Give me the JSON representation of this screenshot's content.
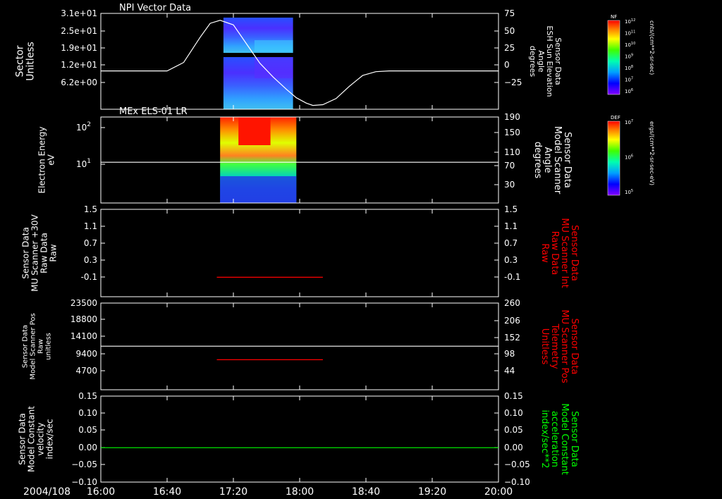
{
  "date_label": "2004/108",
  "time_axis": {
    "ticks": [
      "16:00",
      "16:40",
      "17:20",
      "18:00",
      "18:40",
      "19:20",
      "20:00"
    ],
    "range_minutes": [
      0,
      240
    ]
  },
  "colors": {
    "background": "#000000",
    "axis": "#ffffff",
    "red_series": "#ff0000",
    "green_series": "#00ff00"
  },
  "chart_data": [
    {
      "type": "heatmap",
      "title": "NPI Vector Data",
      "left_axis": {
        "label": [
          "Sector",
          "Unitless"
        ],
        "ticks": [
          "3.1e+01",
          "2.5e+01",
          "1.9e+01",
          "1.2e+01",
          "6.2e+00"
        ]
      },
      "right_axis": {
        "label": [
          "Sensor Data",
          "ESH Sun Elevation",
          "Angle",
          "degrees"
        ],
        "ticks": [
          "75",
          "50",
          "25",
          "0",
          "−25"
        ],
        "range": [
          -50,
          75
        ]
      },
      "spectrogram_time_range": [
        "17:14",
        "17:56"
      ],
      "series": [
        {
          "color": "#ffffff",
          "x_minutes": [
            0,
            40,
            50,
            60,
            66,
            72,
            80,
            88,
            96,
            104,
            112,
            118,
            124,
            128,
            134,
            142,
            150,
            158,
            166,
            174,
            182,
            240
          ],
          "y": [
            0,
            0,
            11,
            44,
            62,
            66,
            60,
            35,
            10,
            -8,
            -24,
            -35,
            -42,
            -45,
            -44,
            -36,
            -20,
            -6,
            -1,
            0,
            0,
            0
          ]
        }
      ],
      "colorbar": {
        "name": "NF",
        "unit": "cnts/(cm**2-sr-sec)",
        "tick_exponents": [
          "12",
          "11",
          "10",
          "9",
          "8",
          "7",
          "6"
        ]
      }
    },
    {
      "type": "heatmap",
      "title": "MEx ELS-01 LR",
      "left_axis": {
        "label": [
          "Electron Energy",
          "eV"
        ],
        "ticks": [
          "10",
          "10"
        ],
        "tick_exponents": [
          "2",
          "1"
        ],
        "scale": "log"
      },
      "right_axis": {
        "label": [
          "Sensor Data",
          "Model Scanner",
          "Angle",
          "degrees"
        ],
        "ticks": [
          "190",
          "150",
          "110",
          "70",
          "30"
        ],
        "range": [
          0,
          190
        ]
      },
      "spectrogram_time_range": [
        "17:12",
        "17:58"
      ],
      "series": [
        {
          "color": "#ffffff",
          "x_minutes": [
            0,
            240
          ],
          "y": [
            90,
            90
          ]
        }
      ],
      "colorbar": {
        "name": "DEF",
        "unit": "ergs/(cm**2-sr-sec-eV)",
        "tick_exponents": [
          "7",
          "6",
          "5"
        ]
      }
    },
    {
      "type": "line",
      "left_axis": {
        "label": [
          "Sensor Data",
          "MU Scanner +30V",
          "Raw Data",
          "Raw"
        ],
        "ticks": [
          "1.5",
          "1.1",
          "0.7",
          "0.3",
          "-0.1"
        ],
        "range": [
          -0.3,
          1.5
        ]
      },
      "right_axis": {
        "label": [
          "Sensor Data",
          "MU Scanner Int",
          "Raw Data",
          "Raw"
        ],
        "label_color": "#ff0000",
        "ticks": [
          "1.5",
          "1.1",
          "0.7",
          "0.3",
          "-0.1"
        ],
        "range": [
          -0.3,
          1.5
        ]
      },
      "series": [
        {
          "color": "#ff0000",
          "x_minutes": [
            70,
            134
          ],
          "y": [
            0.1,
            0.1
          ]
        }
      ]
    },
    {
      "type": "line",
      "left_axis": {
        "label": [
          "Sensor Data",
          "Model Scanner Pos",
          "Raw",
          "unitless"
        ],
        "ticks": [
          "23500",
          "18800",
          "14100",
          "9400",
          "4700"
        ],
        "range": [
          0,
          23500
        ]
      },
      "right_axis": {
        "label": [
          "Sensor Data",
          "MU Scanner Pos",
          "Telemetry",
          "Unitless"
        ],
        "label_color": "#ff0000",
        "ticks": [
          "260",
          "206",
          "152",
          "98",
          "44"
        ],
        "range": [
          0,
          260
        ]
      },
      "series": [
        {
          "color": "#ffffff",
          "axis": "left",
          "x_minutes": [
            0,
            240
          ],
          "y": [
            11800,
            11800
          ]
        },
        {
          "color": "#ff0000",
          "axis": "right",
          "x_minutes": [
            70,
            134
          ],
          "y": [
            90,
            90
          ]
        }
      ]
    },
    {
      "type": "line",
      "left_axis": {
        "label": [
          "Sensor Data",
          "Model Constant",
          "velocity",
          "index/sec"
        ],
        "ticks": [
          "0.15",
          "0.10",
          "0.05",
          "0.00",
          "−0.05",
          "−0.10"
        ],
        "range": [
          -0.1,
          0.15
        ]
      },
      "right_axis": {
        "label": [
          "Sensor Data",
          "Model Constant",
          "acceleration",
          "index/sec**2"
        ],
        "label_color": "#00ff00",
        "ticks": [
          "0.15",
          "0.10",
          "0.05",
          "0.00",
          "−0.05",
          "−0.10"
        ],
        "range": [
          -0.1,
          0.15
        ]
      },
      "series": [
        {
          "color": "#00ff00",
          "x_minutes": [
            0,
            240
          ],
          "y": [
            0,
            0
          ]
        }
      ]
    }
  ]
}
